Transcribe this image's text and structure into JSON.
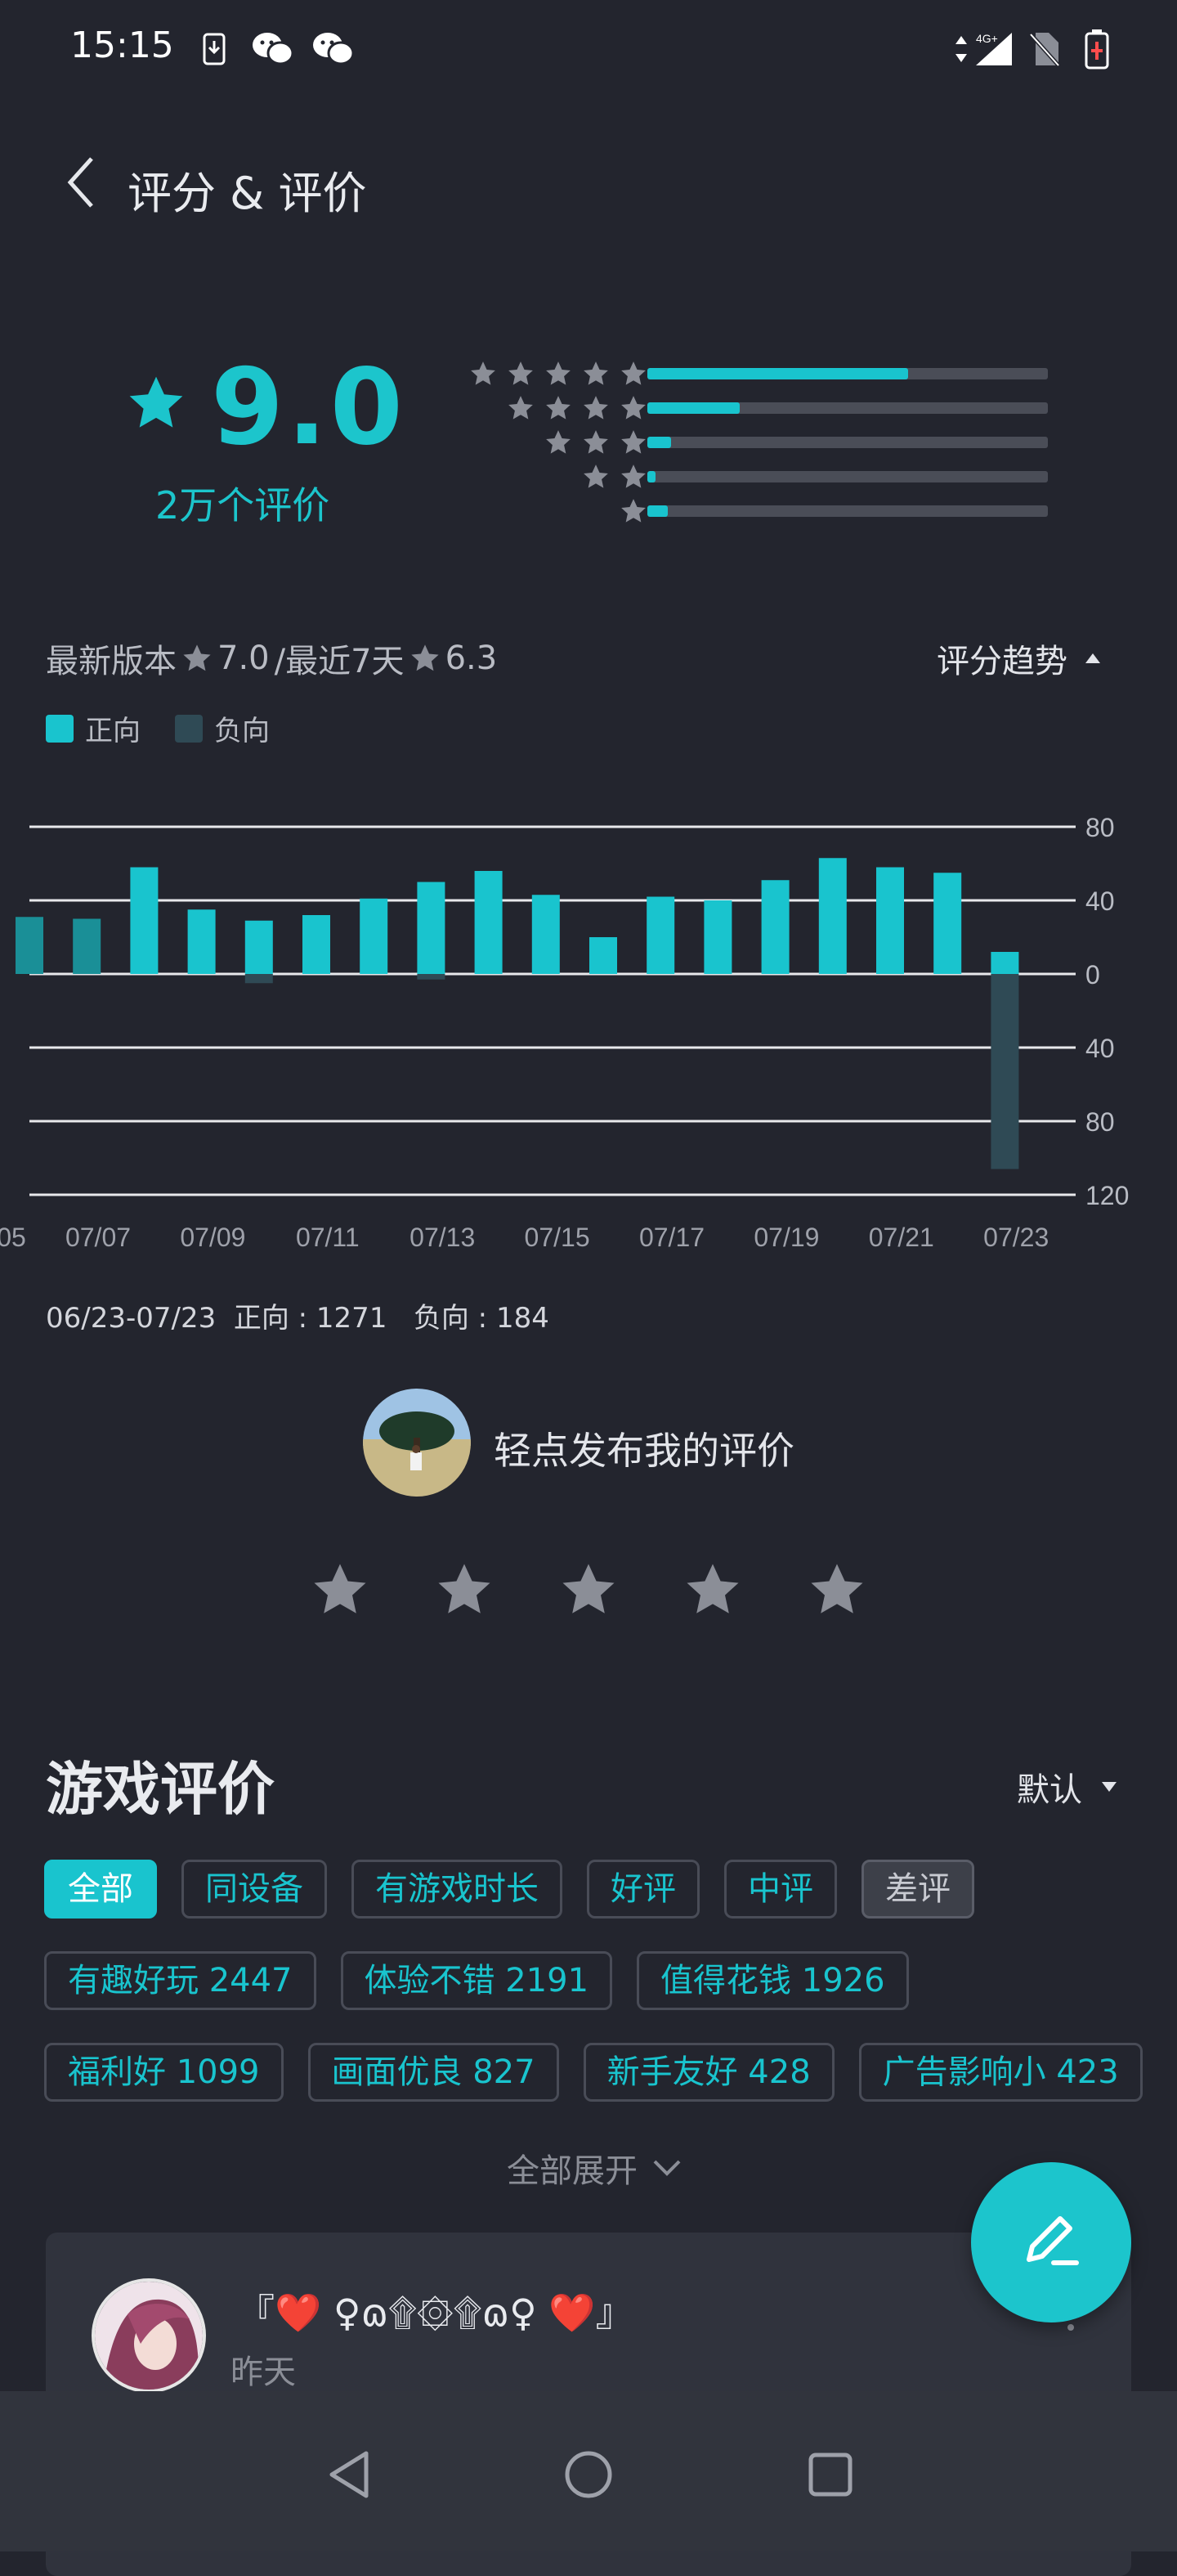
{
  "status_bar": {
    "time": "15:15",
    "left_icons": [
      "download-icon",
      "wechat-icon",
      "wechat-icon"
    ],
    "right_icons": [
      "data-arrows-icon",
      "signal-4g-icon",
      "no-sim-icon",
      "battery-charging-icon"
    ],
    "network_label": "4G+"
  },
  "header": {
    "title": "评分 & 评价",
    "back_icon": "chevron-left-icon"
  },
  "summary": {
    "score": "9.0",
    "count_label": "2万个评价",
    "distribution": [
      {
        "stars": 5,
        "fraction": 0.65
      },
      {
        "stars": 4,
        "fraction": 0.23
      },
      {
        "stars": 3,
        "fraction": 0.06
      },
      {
        "stars": 2,
        "fraction": 0.02
      },
      {
        "stars": 1,
        "fraction": 0.05
      }
    ]
  },
  "version_line": {
    "prefix": "最新版本",
    "latest_version_score": "7.0",
    "separator": "/最近7天",
    "last7_score": "6.3",
    "trend_label": "评分趋势"
  },
  "legend": {
    "positive": "正向",
    "negative": "负向"
  },
  "colors": {
    "accent": "#19c4ce",
    "background": "#23252e",
    "card": "#30333d",
    "negative": "#2f4a55"
  },
  "chart_data": {
    "type": "bar",
    "categories": [
      "07/05",
      "07/06",
      "07/07",
      "07/08",
      "07/09",
      "07/10",
      "07/11",
      "07/12",
      "07/13",
      "07/14",
      "07/15",
      "07/16",
      "07/17",
      "07/18",
      "07/19",
      "07/20",
      "07/21",
      "07/22",
      "07/23"
    ],
    "x_tick_labels": [
      "05",
      "07/07",
      "07/09",
      "07/11",
      "07/13",
      "07/15",
      "07/17",
      "07/19",
      "07/21",
      "07/23"
    ],
    "series": [
      {
        "name": "正向",
        "values": [
          31,
          30,
          58,
          35,
          29,
          32,
          41,
          50,
          56,
          43,
          20,
          42,
          40,
          51,
          63,
          58,
          55,
          12
        ]
      },
      {
        "name": "负向",
        "values": [
          0,
          0,
          0,
          0,
          5,
          0,
          0,
          3,
          0,
          0,
          0,
          0,
          0,
          0,
          0,
          0,
          0,
          106
        ]
      }
    ],
    "y_tick_labels": [
      "80",
      "40",
      "0",
      "40",
      "80",
      "120"
    ],
    "ylim": [
      -120,
      80
    ],
    "grid": true
  },
  "chart_summary": "06/23-07/23  正向 : 1271   负向 : 184",
  "my_review": {
    "prompt": "轻点发布我的评价",
    "star_count": 5
  },
  "reviews_section": {
    "title": "游戏评价",
    "sort_label": "默认",
    "filter_tags": [
      "全部",
      "同设备",
      "有游戏时长",
      "好评",
      "中评",
      "差评"
    ],
    "topic_tags_row1": [
      "有趣好玩 2447",
      "体验不错 2191",
      "值得花钱 1926"
    ],
    "topic_tags_row2": [
      "福利好 1099",
      "画面优良 827",
      "新手友好 428",
      "广告影响小 423"
    ],
    "expand_label": "全部展开"
  },
  "review": {
    "author": "『❤️ ♀ɷ۩۞۩ɷ♀ ❤️』",
    "time": "昨天"
  },
  "nav": {
    "icons": [
      "back-triangle-icon",
      "home-circle-icon",
      "recents-square-icon"
    ]
  }
}
